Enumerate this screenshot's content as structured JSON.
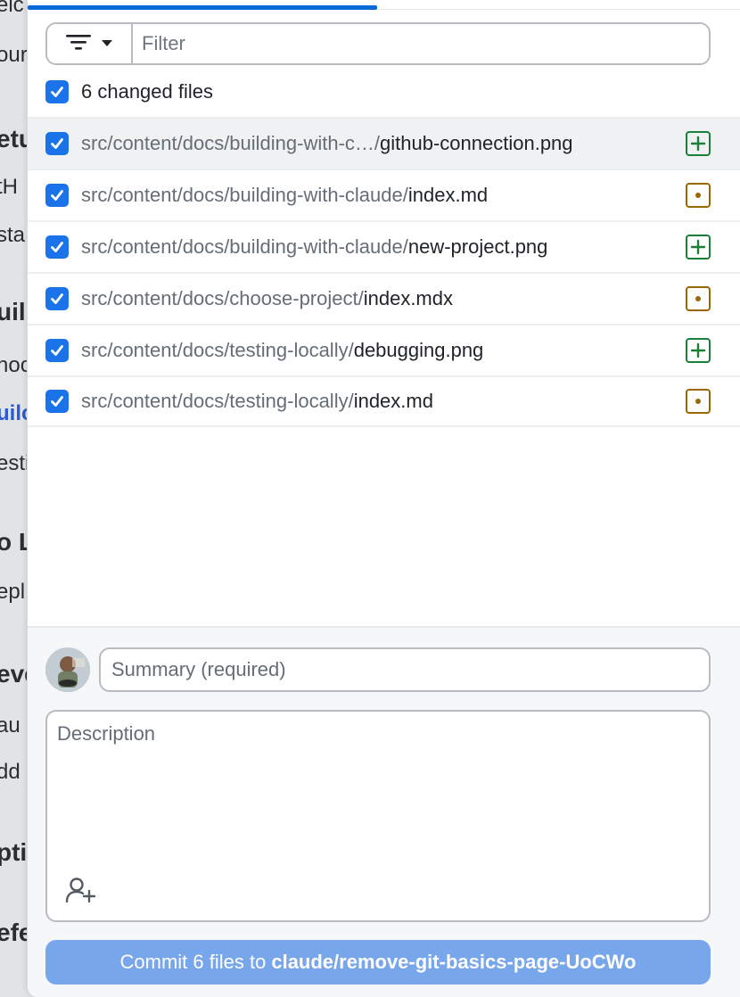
{
  "background_fragments": [
    {
      "text": "elc",
      "style": "normal"
    },
    {
      "text": "our",
      "style": "normal"
    },
    {
      "text": "etu",
      "style": "bold"
    },
    {
      "text": "tH",
      "style": "normal"
    },
    {
      "text": "sta",
      "style": "normal"
    },
    {
      "text": "uil",
      "style": "bold"
    },
    {
      "text": "noc",
      "style": "normal"
    },
    {
      "text": "uilc",
      "style": "link"
    },
    {
      "text": "esti",
      "style": "normal"
    },
    {
      "text": "o L",
      "style": "bold"
    },
    {
      "text": "epl",
      "style": "normal"
    },
    {
      "text": "eve",
      "style": "bold"
    },
    {
      "text": "au",
      "style": "normal"
    },
    {
      "text": "dd",
      "style": "normal"
    },
    {
      "text": "pti",
      "style": "bold"
    },
    {
      "text": "efe",
      "style": "bold"
    }
  ],
  "filter": {
    "placeholder": "Filter",
    "value": "",
    "button_icon": "filter-lines-icon",
    "caret_icon": "caret-down-icon"
  },
  "changes": {
    "select_all_checked": true,
    "count_label": "6 changed files"
  },
  "files": [
    {
      "dir": "src/content/docs/building-with-c…/",
      "name": "github-connection.png",
      "status": "added",
      "checked": true,
      "selected": true
    },
    {
      "dir": "src/content/docs/building-with-claude/",
      "name": "index.md",
      "status": "modified",
      "checked": true,
      "selected": false
    },
    {
      "dir": "src/content/docs/building-with-claude/",
      "name": "new-project.png",
      "status": "added",
      "checked": true,
      "selected": false
    },
    {
      "dir": "src/content/docs/choose-project/",
      "name": "index.mdx",
      "status": "modified",
      "checked": true,
      "selected": false
    },
    {
      "dir": "src/content/docs/testing-locally/",
      "name": "debugging.png",
      "status": "added",
      "checked": true,
      "selected": false
    },
    {
      "dir": "src/content/docs/testing-locally/",
      "name": "index.md",
      "status": "modified",
      "checked": true,
      "selected": false
    }
  ],
  "commit": {
    "summary_placeholder": "Summary (required)",
    "summary_value": "",
    "description_placeholder": "Description",
    "description_value": "",
    "coauthor_icon": "add-coauthor-icon",
    "button_prefix": "Commit 6 files to",
    "branch": "claude/remove-git-basics-page-UoCWo"
  },
  "colors": {
    "accent": "#0969da",
    "checkbox": "#1a73e8",
    "added": "#1a7f37",
    "modified": "#9a6700",
    "commit_button": "#78a6ea"
  }
}
